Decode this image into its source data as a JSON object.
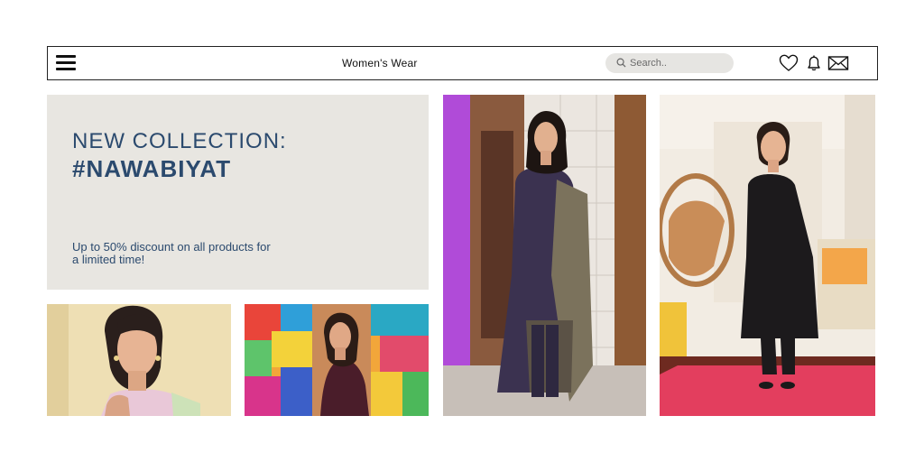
{
  "header": {
    "title": "Women's Wear",
    "search_placeholder": "Search.."
  },
  "hero": {
    "line1": "NEW COLLECTION:",
    "line2": "#NAWABIYAT",
    "subtitle": "Up to 50% discount on all products for a limited time!"
  },
  "icons": {
    "menu": "hamburger-menu-icon",
    "search": "search-icon",
    "wishlist": "heart-icon",
    "notifications": "bell-icon",
    "messages": "envelope-icon"
  },
  "colors": {
    "accent_text": "#2b4a6e",
    "hero_bg": "#e8e6e1",
    "search_bg": "#e6e5e2"
  }
}
